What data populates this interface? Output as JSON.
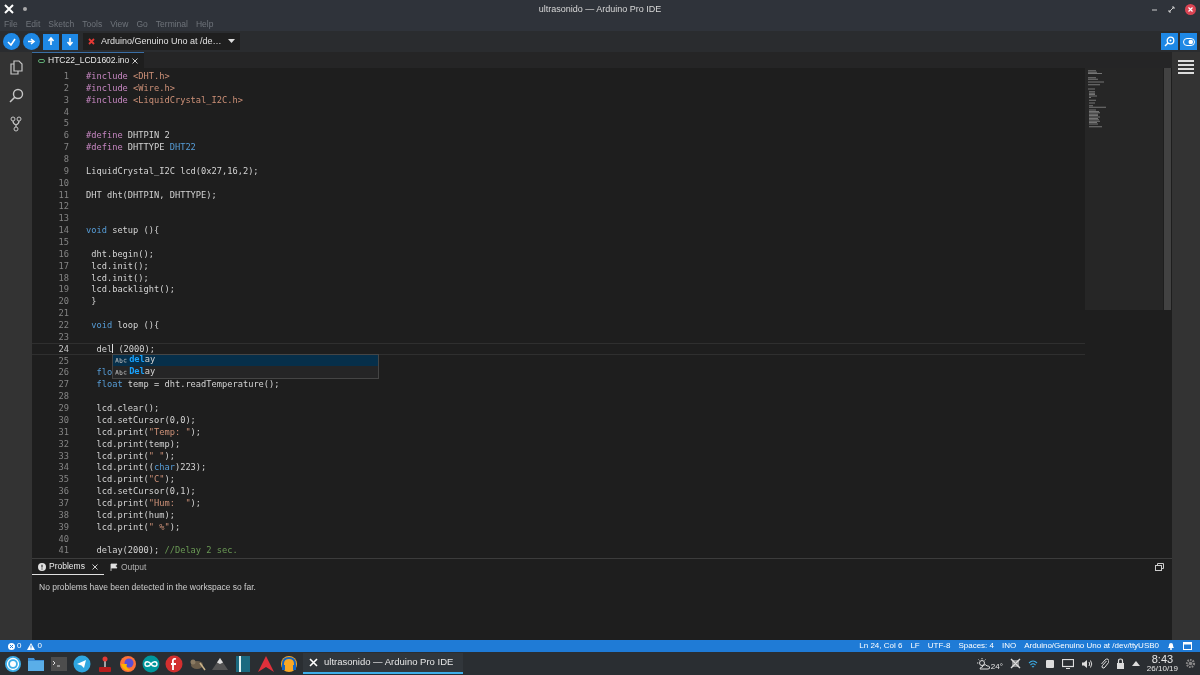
{
  "window": {
    "title": "ultrasonido — Arduino Pro IDE"
  },
  "menu": [
    "File",
    "Edit",
    "Sketch",
    "Tools",
    "View",
    "Go",
    "Terminal",
    "Help"
  ],
  "toolbar": {
    "board": "Arduino/Genuino Uno at /de…"
  },
  "editor_tabs": [
    {
      "label": "HTC22_LCD1602.ino",
      "selected": true
    }
  ],
  "editor": {
    "lines": [
      {
        "number": "1",
        "current": false,
        "tokens": [
          {
            "kind": "pp",
            "text": "#include "
          },
          {
            "kind": "str",
            "text": "<DHT.h>"
          }
        ]
      },
      {
        "number": "2",
        "current": false,
        "tokens": [
          {
            "kind": "pp",
            "text": "#include "
          },
          {
            "kind": "str",
            "text": "<Wire.h>"
          }
        ]
      },
      {
        "number": "3",
        "current": false,
        "tokens": [
          {
            "kind": "pp",
            "text": "#include "
          },
          {
            "kind": "str",
            "text": "<LiquidCrystal_I2C.h>"
          }
        ]
      },
      {
        "number": "4",
        "current": false
      },
      {
        "number": "5",
        "current": false
      },
      {
        "number": "6",
        "current": false,
        "tokens": [
          {
            "kind": "pp",
            "text": "#define "
          },
          {
            "kind": "plain",
            "text": "DHTPIN 2"
          }
        ]
      },
      {
        "number": "7",
        "current": false,
        "tokens": [
          {
            "kind": "pp",
            "text": "#define "
          },
          {
            "kind": "plain",
            "text": "DHTTYPE "
          },
          {
            "kind": "kw",
            "text": "DHT22"
          }
        ]
      },
      {
        "number": "8",
        "current": false
      },
      {
        "number": "9",
        "current": false,
        "tokens": [
          {
            "kind": "plain",
            "text": "LiquidCrystal_I2C lcd(0x27,16,2);"
          }
        ]
      },
      {
        "number": "10",
        "current": false
      },
      {
        "number": "11",
        "current": false,
        "tokens": [
          {
            "kind": "plain",
            "text": "DHT dht(DHTPIN, DHTTYPE);"
          }
        ]
      },
      {
        "number": "12",
        "current": false
      },
      {
        "number": "13",
        "current": false
      },
      {
        "number": "14",
        "current": false,
        "tokens": [
          {
            "kind": "kw",
            "text": "void"
          },
          {
            "kind": "plain",
            "text": " setup (){"
          }
        ]
      },
      {
        "number": "15",
        "current": false
      },
      {
        "number": "16",
        "current": false,
        "tokens": [
          {
            "kind": "plain",
            "text": " dht.begin();"
          }
        ]
      },
      {
        "number": "17",
        "current": false,
        "tokens": [
          {
            "kind": "plain",
            "text": " lcd.init();"
          }
        ]
      },
      {
        "number": "18",
        "current": false,
        "tokens": [
          {
            "kind": "plain",
            "text": " lcd.init();"
          }
        ]
      },
      {
        "number": "19",
        "current": false,
        "tokens": [
          {
            "kind": "plain",
            "text": " lcd.backlight();"
          }
        ]
      },
      {
        "number": "20",
        "current": false,
        "tokens": [
          {
            "kind": "plain",
            "text": " }"
          }
        ]
      },
      {
        "number": "21",
        "current": false
      },
      {
        "number": "22",
        "current": false,
        "tokens": [
          {
            "kind": "kw",
            "text": " void"
          },
          {
            "kind": "plain",
            "text": " loop (){"
          }
        ]
      },
      {
        "number": "23",
        "current": false
      },
      {
        "number": "24",
        "current": true,
        "tokens": [
          {
            "kind": "plain",
            "text": "  del"
          },
          {
            "kind": "cursor"
          },
          {
            "kind": "plain",
            "text": " (2000);"
          }
        ]
      },
      {
        "number": "25",
        "current": false
      },
      {
        "number": "26",
        "current": false,
        "tokens": [
          {
            "kind": "kw",
            "text": "  flo"
          }
        ]
      },
      {
        "number": "27",
        "current": false,
        "tokens": [
          {
            "kind": "kw",
            "text": "  float"
          },
          {
            "kind": "plain",
            "text": " temp = dht.readTemperature();"
          }
        ]
      },
      {
        "number": "28",
        "current": false
      },
      {
        "number": "29",
        "current": false,
        "tokens": [
          {
            "kind": "plain",
            "text": "  lcd.clear();"
          }
        ]
      },
      {
        "number": "30",
        "current": false,
        "tokens": [
          {
            "kind": "plain",
            "text": "  lcd.setCursor(0,0);"
          }
        ]
      },
      {
        "number": "31",
        "current": false,
        "tokens": [
          {
            "kind": "plain",
            "text": "  lcd.print("
          },
          {
            "kind": "str",
            "text": "\"Temp: \""
          },
          {
            "kind": "plain",
            "text": ");"
          }
        ]
      },
      {
        "number": "32",
        "current": false,
        "tokens": [
          {
            "kind": "plain",
            "text": "  lcd.print(temp);"
          }
        ]
      },
      {
        "number": "33",
        "current": false,
        "tokens": [
          {
            "kind": "plain",
            "text": "  lcd.print("
          },
          {
            "kind": "str",
            "text": "\" \""
          },
          {
            "kind": "plain",
            "text": ");"
          }
        ]
      },
      {
        "number": "34",
        "current": false,
        "tokens": [
          {
            "kind": "plain",
            "text": "  lcd.print(("
          },
          {
            "kind": "kw",
            "text": "char"
          },
          {
            "kind": "plain",
            "text": ")223);"
          }
        ]
      },
      {
        "number": "35",
        "current": false,
        "tokens": [
          {
            "kind": "plain",
            "text": "  lcd.print("
          },
          {
            "kind": "str",
            "text": "\"C\""
          },
          {
            "kind": "plain",
            "text": ");"
          }
        ]
      },
      {
        "number": "36",
        "current": false,
        "tokens": [
          {
            "kind": "plain",
            "text": "  lcd.setCursor(0,1);"
          }
        ]
      },
      {
        "number": "37",
        "current": false,
        "tokens": [
          {
            "kind": "plain",
            "text": "  lcd.print("
          },
          {
            "kind": "str",
            "text": "\"Hum:  \""
          },
          {
            "kind": "plain",
            "text": ");"
          }
        ]
      },
      {
        "number": "38",
        "current": false,
        "tokens": [
          {
            "kind": "plain",
            "text": "  lcd.print(hum);"
          }
        ]
      },
      {
        "number": "39",
        "current": false,
        "tokens": [
          {
            "kind": "plain",
            "text": "  lcd.print("
          },
          {
            "kind": "str",
            "text": "\" %\""
          },
          {
            "kind": "plain",
            "text": ");"
          }
        ]
      },
      {
        "number": "40",
        "current": false
      },
      {
        "number": "41",
        "current": false,
        "tokens": [
          {
            "kind": "plain",
            "text": "  delay(2000); "
          },
          {
            "kind": "cm",
            "text": "//Delay 2 sec."
          }
        ]
      }
    ],
    "suggestions": [
      {
        "match": "del",
        "rest": "ay",
        "selected": true
      },
      {
        "match": "Del",
        "rest": "ay",
        "selected": false
      }
    ]
  },
  "panel": {
    "tabs": [
      {
        "label": "Problems",
        "kind": "problems",
        "selected": true
      },
      {
        "label": "Output",
        "kind": "output",
        "selected": false
      }
    ],
    "message": "No problems have been detected in the workspace so far."
  },
  "status_bar": {
    "errors": "0",
    "warnings": "0",
    "items": [
      "Ln 24, Col 6",
      "LF",
      "UTF-8",
      "Spaces: 4",
      "INO",
      "Arduino/Genuino Uno at /dev/ttyUSB0"
    ]
  },
  "taskbar": {
    "tasks": [
      {
        "label": "ultrasonido — Arduino Pro IDE",
        "selected": true
      }
    ],
    "weather": "24°",
    "time": "8:43",
    "date": "26/10/19"
  }
}
